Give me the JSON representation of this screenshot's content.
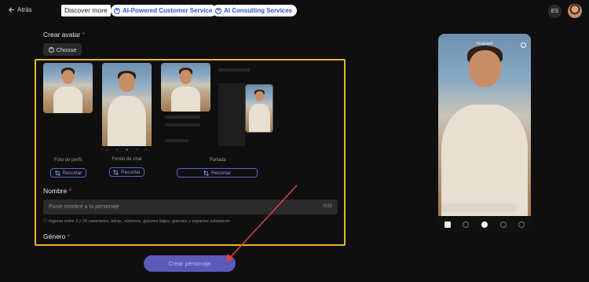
{
  "topbar": {
    "back_label": "Atrás",
    "discover_label": "Discover more",
    "pill1_label": "AI-Powered Customer Service",
    "pill2_label": "AI Consulting Services",
    "lang_label": "ES"
  },
  "form": {
    "avatar_label": "Crear avatar",
    "required_mark": "*",
    "choose_label": "Choose",
    "previews": [
      {
        "caption": "Foto de perfil",
        "button": "Recortar"
      },
      {
        "caption": "Fondo de chat",
        "button": "Recortar"
      },
      {
        "caption": "Portada",
        "button": "Recortar"
      }
    ],
    "name_label": "Nombre",
    "name_placeholder": "Ponle nombre a tu personaje",
    "name_count": "0/25",
    "name_hint": "Ingresa entre 3 y 25 caracteres, letras, números, guiones bajos, guiones y espacios solamente",
    "gender_label": "Género",
    "submit_label": "Crear personaje"
  },
  "phone_preview": {
    "tab_label": "Featured"
  },
  "colors": {
    "highlight": "#e9b52d",
    "accent": "#5a5bb8",
    "arrow": "#e0413a"
  }
}
